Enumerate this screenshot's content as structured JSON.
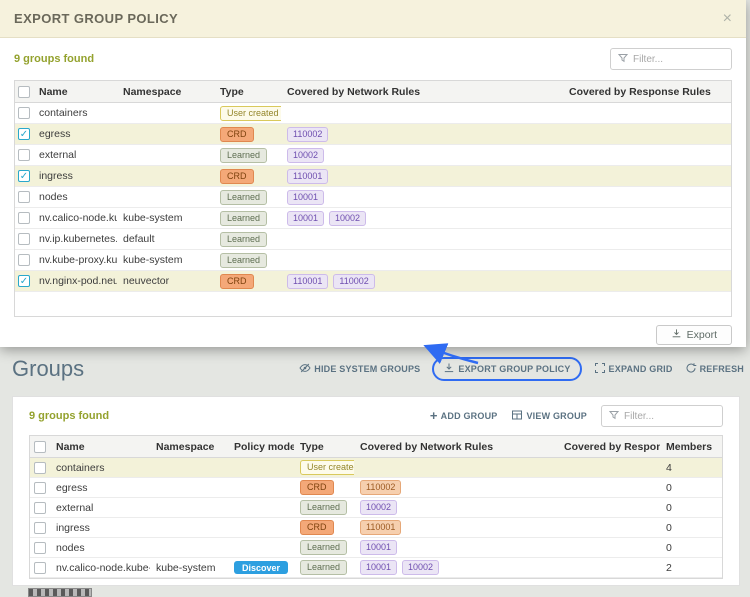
{
  "colors": {
    "accent_green": "#94a22e",
    "modal_header_bg": "#f6f2dd",
    "crd_badge": "#f4a878",
    "learned_badge": "#e6e9df",
    "user_badge_border": "#d9c95c",
    "rule_purple": "#ebe5f5",
    "rule_orange": "#f6cfae",
    "discover_blue": "#2d9fe0",
    "annotation_blue": "#2f6bf2",
    "toolbar_text": "#5b7282"
  },
  "icons": {
    "close": "x",
    "filter": "funnel",
    "export": "download",
    "hide_system_groups": "eye-off",
    "export_group_policy": "download",
    "expand_grid": "expand",
    "refresh": "refresh",
    "add_group": "plus",
    "view_group": "grid",
    "checkbox_check": "check"
  },
  "modal": {
    "title": "EXPORT GROUP POLICY",
    "close_label": "×",
    "count_text": "9 groups found",
    "filter_placeholder": "Filter...",
    "export_label": "Export",
    "columns": {
      "name": "Name",
      "namespace": "Namespace",
      "type": "Type",
      "network": "Covered by Network Rules",
      "response": "Covered by Response Rules"
    },
    "rows": [
      {
        "name": "containers",
        "namespace": "",
        "type": "User created",
        "type_kind": "user",
        "rules": [],
        "rule_kind": "purple",
        "checked": false
      },
      {
        "name": "egress",
        "namespace": "",
        "type": "CRD",
        "type_kind": "crd",
        "rules": [
          "110002"
        ],
        "rule_kind": "purple",
        "checked": true
      },
      {
        "name": "external",
        "namespace": "",
        "type": "Learned",
        "type_kind": "learned",
        "rules": [
          "10002"
        ],
        "rule_kind": "purple",
        "checked": false
      },
      {
        "name": "ingress",
        "namespace": "",
        "type": "CRD",
        "type_kind": "crd",
        "rules": [
          "110001"
        ],
        "rule_kind": "purple",
        "checked": true
      },
      {
        "name": "nodes",
        "namespace": "",
        "type": "Learned",
        "type_kind": "learned",
        "rules": [
          "10001"
        ],
        "rule_kind": "purple",
        "checked": false
      },
      {
        "name": "nv.calico-node.kub",
        "namespace": "kube-system",
        "type": "Learned",
        "type_kind": "learned",
        "rules": [
          "10001",
          "10002"
        ],
        "rule_kind": "purple",
        "checked": false
      },
      {
        "name": "nv.ip.kubernetes.d",
        "namespace": "default",
        "type": "Learned",
        "type_kind": "learned",
        "rules": [],
        "rule_kind": "purple",
        "checked": false
      },
      {
        "name": "nv.kube-proxy.kub",
        "namespace": "kube-system",
        "type": "Learned",
        "type_kind": "learned",
        "rules": [],
        "rule_kind": "purple",
        "checked": false
      },
      {
        "name": "nv.nginx-pod.neuv",
        "namespace": "neuvector",
        "type": "CRD",
        "type_kind": "crd",
        "rules": [
          "110001",
          "110002"
        ],
        "rule_kind": "purple",
        "checked": true
      }
    ]
  },
  "page": {
    "title": "Groups",
    "toolbar": {
      "hide_system_groups": "HIDE SYSTEM GROUPS",
      "export_group_policy": "EXPORT GROUP POLICY",
      "expand_grid": "EXPAND GRID",
      "refresh": "REFRESH"
    },
    "count_text": "9 groups found",
    "add_group": "ADD GROUP",
    "view_group": "VIEW GROUP",
    "filter_placeholder": "Filter...",
    "columns": {
      "name": "Name",
      "namespace": "Namespace",
      "policy_mode": "Policy mode",
      "type": "Type",
      "network": "Covered by Network Rules",
      "response": "Covered by Response R...",
      "members": "Members"
    },
    "rows": [
      {
        "name": "containers",
        "namespace": "",
        "policy_mode": "",
        "type": "User created",
        "type_kind": "user",
        "rules": [],
        "rule_kind": "purple",
        "members": "4",
        "selected": true
      },
      {
        "name": "egress",
        "namespace": "",
        "policy_mode": "",
        "type": "CRD",
        "type_kind": "crd",
        "rules": [
          "110002"
        ],
        "rule_kind": "orange",
        "members": "0",
        "selected": false
      },
      {
        "name": "external",
        "namespace": "",
        "policy_mode": "",
        "type": "Learned",
        "type_kind": "learned",
        "rules": [
          "10002"
        ],
        "rule_kind": "purple",
        "members": "0",
        "selected": false
      },
      {
        "name": "ingress",
        "namespace": "",
        "policy_mode": "",
        "type": "CRD",
        "type_kind": "crd",
        "rules": [
          "110001"
        ],
        "rule_kind": "orange",
        "members": "0",
        "selected": false
      },
      {
        "name": "nodes",
        "namespace": "",
        "policy_mode": "",
        "type": "Learned",
        "type_kind": "learned",
        "rules": [
          "10001"
        ],
        "rule_kind": "purple",
        "members": "0",
        "selected": false
      },
      {
        "name": "nv.calico-node.kube-sys",
        "namespace": "kube-system",
        "policy_mode": "Discover",
        "type": "Learned",
        "type_kind": "learned",
        "rules": [
          "10001",
          "10002"
        ],
        "rule_kind": "purple",
        "members": "2",
        "selected": false
      }
    ]
  }
}
